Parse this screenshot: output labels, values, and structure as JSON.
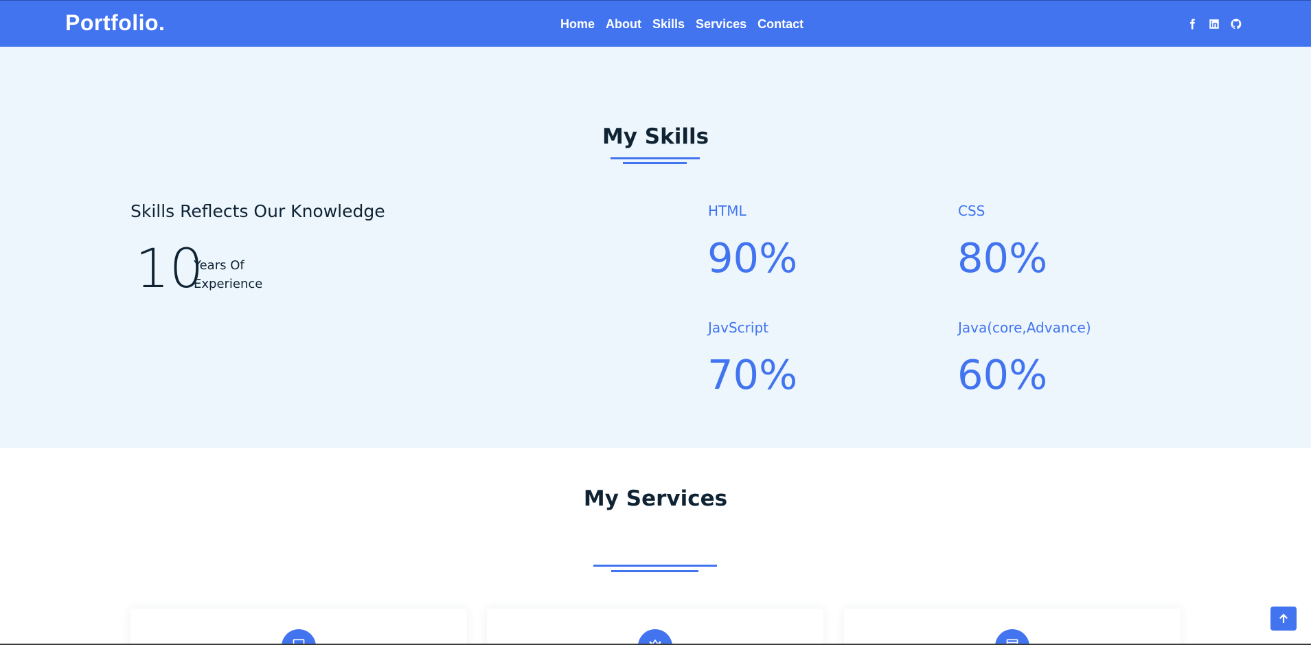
{
  "header": {
    "brand": "Portfolio.",
    "nav": [
      "Home",
      "About",
      "Skills",
      "Services",
      "Contact"
    ],
    "socials": [
      "facebook-icon",
      "linkedin-icon",
      "github-icon"
    ],
    "accent": "#4274f0"
  },
  "skills": {
    "title": "My Skills",
    "subheading": "Skills Reflects Our Knowledge",
    "years": "10",
    "years_label": "Years Of Experience",
    "items": [
      {
        "name": "HTML",
        "percent": "90%"
      },
      {
        "name": "CSS",
        "percent": "80%"
      },
      {
        "name": "JavScript",
        "percent": "70%"
      },
      {
        "name": "Java(core,Advance)",
        "percent": "60%"
      }
    ]
  },
  "services": {
    "title": "My Services",
    "cards": [
      {
        "icon": "monitor-icon"
      },
      {
        "icon": "crown-icon"
      },
      {
        "icon": "browser-icon"
      }
    ]
  },
  "scroll_top": {
    "icon": "arrow-up-icon"
  }
}
